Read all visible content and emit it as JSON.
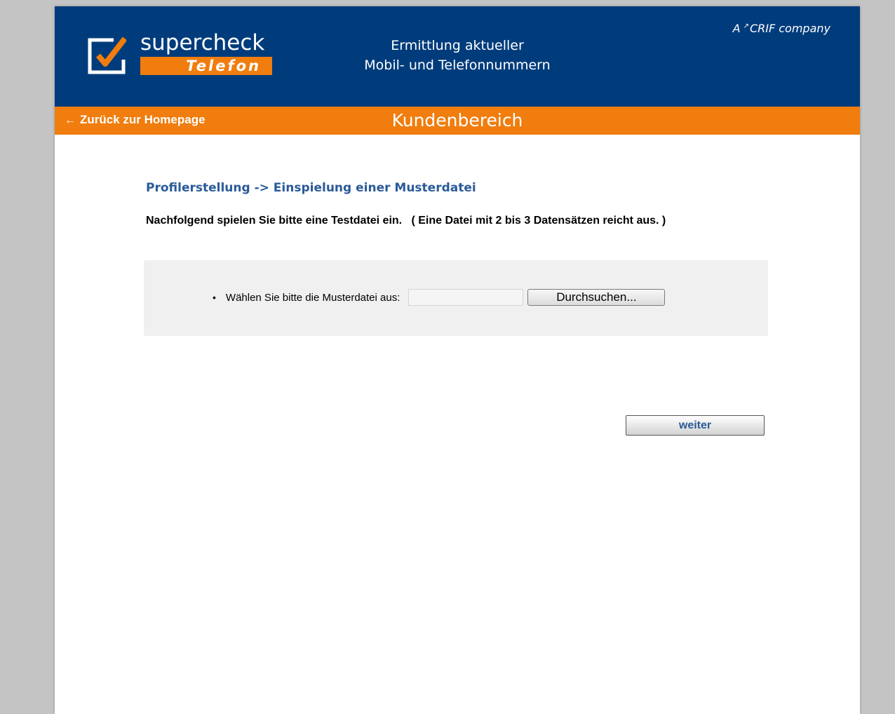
{
  "colors": {
    "brand_blue": "#003c7c",
    "brand_orange": "#f07d0e",
    "title_blue": "#2a5a98",
    "panel_gray": "#f0f0f0"
  },
  "header": {
    "logo": {
      "word": "supercheck",
      "sub": "Telefon",
      "icon": "checkbox-check-icon"
    },
    "tagline_line1": "Ermittlung aktueller",
    "tagline_line2": "Mobil- und Telefonnummern",
    "crif_prefix": "A",
    "crif_name": "CRIF company"
  },
  "navbar": {
    "back_icon": "arrow-left-icon",
    "back_label": "Zurück zur Homepage",
    "title": "Kundenbereich"
  },
  "main": {
    "title": "Profilerstellung -> Einspielung einer Musterdatei",
    "instruction": "Nachfolgend spielen Sie bitte eine Testdatei ein.   ( Eine Datei mit 2 bis 3 Datensätzen reicht aus. )",
    "upload": {
      "bullet": "•",
      "label": "Wählen Sie bitte die Musterdatei aus:",
      "file_value": "",
      "browse_label": "Durchsuchen..."
    },
    "next_label": "weiter"
  }
}
